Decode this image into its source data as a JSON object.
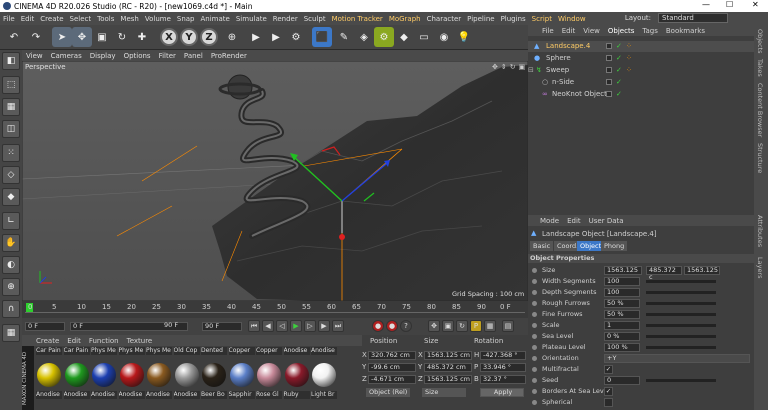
{
  "window": {
    "title": "CINEMA 4D R20.026 Studio (RC - R20) - [new1069.c4d *] - Main",
    "minimize": "—",
    "maximize": "☐",
    "close": "✕"
  },
  "menubar": {
    "items": [
      "File",
      "Edit",
      "Create",
      "Select",
      "Tools",
      "Mesh",
      "Volume",
      "Snap",
      "Animate",
      "Simulate",
      "Render",
      "Sculpt",
      "Motion Tracker",
      "MoGraph",
      "Character",
      "Pipeline",
      "Plugins",
      "Script",
      "Window"
    ],
    "layout_label": "Layout:",
    "layout_value": "Standard"
  },
  "toolbar": {
    "axis_x": "X",
    "axis_y": "Y",
    "axis_z": "Z"
  },
  "viewport": {
    "menu": [
      "View",
      "Cameras",
      "Display",
      "Options",
      "Filter",
      "Panel",
      "ProRender"
    ],
    "label": "Perspective",
    "grid_spacing": "Grid Spacing : 100 cm"
  },
  "timeline": {
    "ticks": [
      "0",
      "5",
      "10",
      "15",
      "20",
      "25",
      "30",
      "35",
      "40",
      "45",
      "50",
      "55",
      "60",
      "65",
      "70",
      "75",
      "80",
      "85",
      "90"
    ],
    "frame_end": "0 F"
  },
  "transport": {
    "start": "0 F",
    "current": "0 F",
    "end": "90 F",
    "end2": "90 F"
  },
  "materials": {
    "menu": [
      "Create",
      "Edit",
      "Function",
      "Texture"
    ],
    "top_labels": [
      "Car Pain",
      "Car Pain",
      "Phys Me",
      "Phys Me",
      "Phys Me",
      "Old Cop",
      "Dented",
      "Copper",
      "Copper",
      "Anodise",
      "Anodise"
    ],
    "balls": [
      {
        "label": "Anodise",
        "color": "#d8c200"
      },
      {
        "label": "Anodise",
        "color": "#1f9a1f"
      },
      {
        "label": "Anodise",
        "color": "#1c3fb0"
      },
      {
        "label": "Anodise",
        "color": "#b8181a"
      },
      {
        "label": "Anodise",
        "color": "#8a5a20"
      },
      {
        "label": "Anodise",
        "color": "#9a9a9a"
      },
      {
        "label": "Beer Bo",
        "color": "#2a2218"
      },
      {
        "label": "Sapphir",
        "color": "#5b7fc8"
      },
      {
        "label": "Rose Gl",
        "color": "#c88a9a"
      },
      {
        "label": "Ruby",
        "color": "#8a1a2a"
      },
      {
        "label": "Light Br",
        "color": "#f2f2f2"
      }
    ],
    "brand": "MAXON CINEMA 4D"
  },
  "coords": {
    "headers": [
      "Position",
      "Size",
      "Rotation"
    ],
    "rows": [
      {
        "axis": "X",
        "pos": "320.762 cm",
        "size_axis": "X",
        "size": "1563.125 cm",
        "rot_axis": "H",
        "rot": "-427.368 °"
      },
      {
        "axis": "Y",
        "pos": "-99.6 cm",
        "size_axis": "Y",
        "size": "485.372 cm",
        "rot_axis": "P",
        "rot": "33.946 °"
      },
      {
        "axis": "Z",
        "pos": "-4.671 cm",
        "size_axis": "Z",
        "size": "1563.125 cm",
        "rot_axis": "B",
        "rot": "32.37 °"
      }
    ],
    "mode": "Object (Rel)",
    "size_mode": "Size",
    "apply": "Apply"
  },
  "objects": {
    "menu": [
      "File",
      "Edit",
      "View",
      "Objects",
      "Tags",
      "Bookmarks"
    ],
    "items": [
      {
        "name": "Landscape.4",
        "color": "#ffcc66"
      },
      {
        "name": "Sphere",
        "color": "#dddddd"
      },
      {
        "name": "Sweep",
        "color": "#dddddd"
      },
      {
        "name": "n-Side",
        "color": "#dddddd"
      },
      {
        "name": "NeoKnot Object",
        "color": "#dddddd"
      }
    ]
  },
  "attributes": {
    "menu": [
      "Mode",
      "Edit",
      "User Data"
    ],
    "title": "Landscape Object [Landscape.4]",
    "tabs": [
      "Basic",
      "Coord.",
      "Object",
      "Phong"
    ],
    "section": "Object Properties",
    "size_label": "Size",
    "size_x": "1563.125",
    "size_y": "485.372 c",
    "size_z": "1563.125",
    "rows": [
      {
        "label": "Width Segments",
        "value": "100"
      },
      {
        "label": "Depth Segments",
        "value": "100"
      },
      {
        "label": "Rough Furrows",
        "value": "50 %"
      },
      {
        "label": "Fine Furrows",
        "value": "50 %"
      },
      {
        "label": "Scale",
        "value": "1"
      },
      {
        "label": "Sea Level",
        "value": "0 %"
      },
      {
        "label": "Plateau Level",
        "value": "100 %"
      },
      {
        "label": "Orientation",
        "value": "+Y"
      },
      {
        "label": "Multifractal",
        "value": "✓"
      },
      {
        "label": "Seed",
        "value": "0"
      },
      {
        "label": "Borders At Sea Level",
        "value": "✓"
      },
      {
        "label": "Spherical",
        "value": ""
      }
    ]
  },
  "righttabs": [
    "Objects",
    "Takes",
    "Content Browser",
    "Structure",
    "Attributes",
    "Layers"
  ]
}
